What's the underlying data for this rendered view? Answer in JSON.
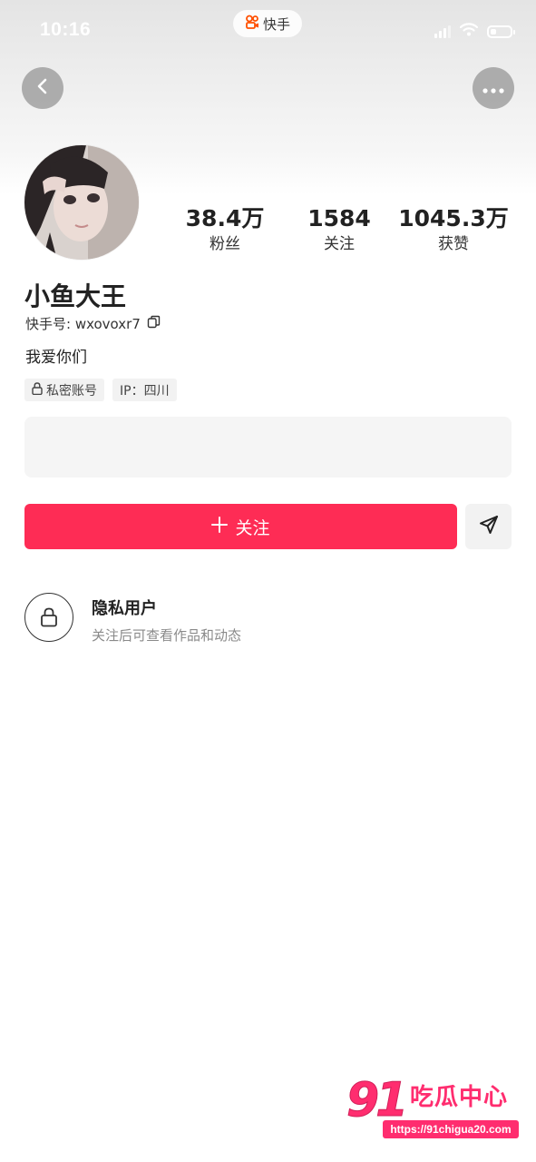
{
  "status_bar": {
    "time": "10:16",
    "app_name": "快手",
    "battery_level": 0.3
  },
  "header": {
    "back_icon": "chevron-left-icon",
    "more_icon": "more-dots-icon"
  },
  "profile": {
    "stats": [
      {
        "value": "38.4万",
        "label": "粉丝"
      },
      {
        "value": "1584",
        "label": "关注"
      },
      {
        "value": "1045.3万",
        "label": "获赞"
      }
    ],
    "username": "小鱼大王",
    "user_id": "快手号: wxovoxr7",
    "bio": "我爱你们",
    "tags": [
      {
        "label": "私密账号",
        "icon": "lock-icon"
      },
      {
        "label": "IP：四川"
      }
    ]
  },
  "actions": {
    "follow_label": "关注",
    "follow_color": "#fe2c55",
    "share_icon": "send-icon"
  },
  "private_notice": {
    "title": "隐私用户",
    "subtitle": "关注后可查看作品和动态"
  },
  "watermark": {
    "number": "91",
    "text": "吃瓜中心",
    "url": "https://91chigua20.com"
  }
}
